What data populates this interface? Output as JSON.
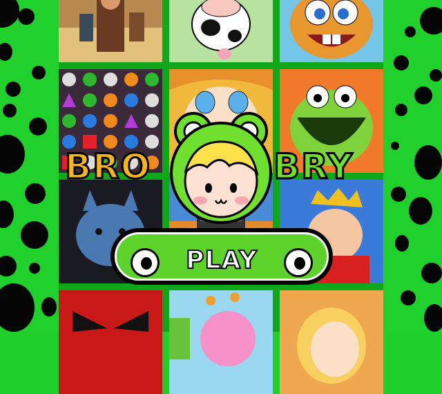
{
  "logo": {
    "word_left": "BRO",
    "word_right": "BRY"
  },
  "play_button": {
    "label": "PLAY"
  },
  "colors": {
    "background": "#20d02b",
    "grid": "#0ea81a",
    "play_fill": "#5cd22b",
    "logo_left": "#f7b51c",
    "logo_right": "#6fe02e"
  },
  "game_tiles": [
    {
      "name": "warrior-tile"
    },
    {
      "name": "cow-tile"
    },
    {
      "name": "beaver-tile"
    },
    {
      "name": "jewels-tile"
    },
    {
      "name": "doll-tile"
    },
    {
      "name": "monster-tile"
    },
    {
      "name": "cat-tile"
    },
    {
      "name": "car-tile"
    },
    {
      "name": "king-tile"
    },
    {
      "name": "bird-tile"
    },
    {
      "name": "snail-tile"
    },
    {
      "name": "girl-tile"
    }
  ]
}
